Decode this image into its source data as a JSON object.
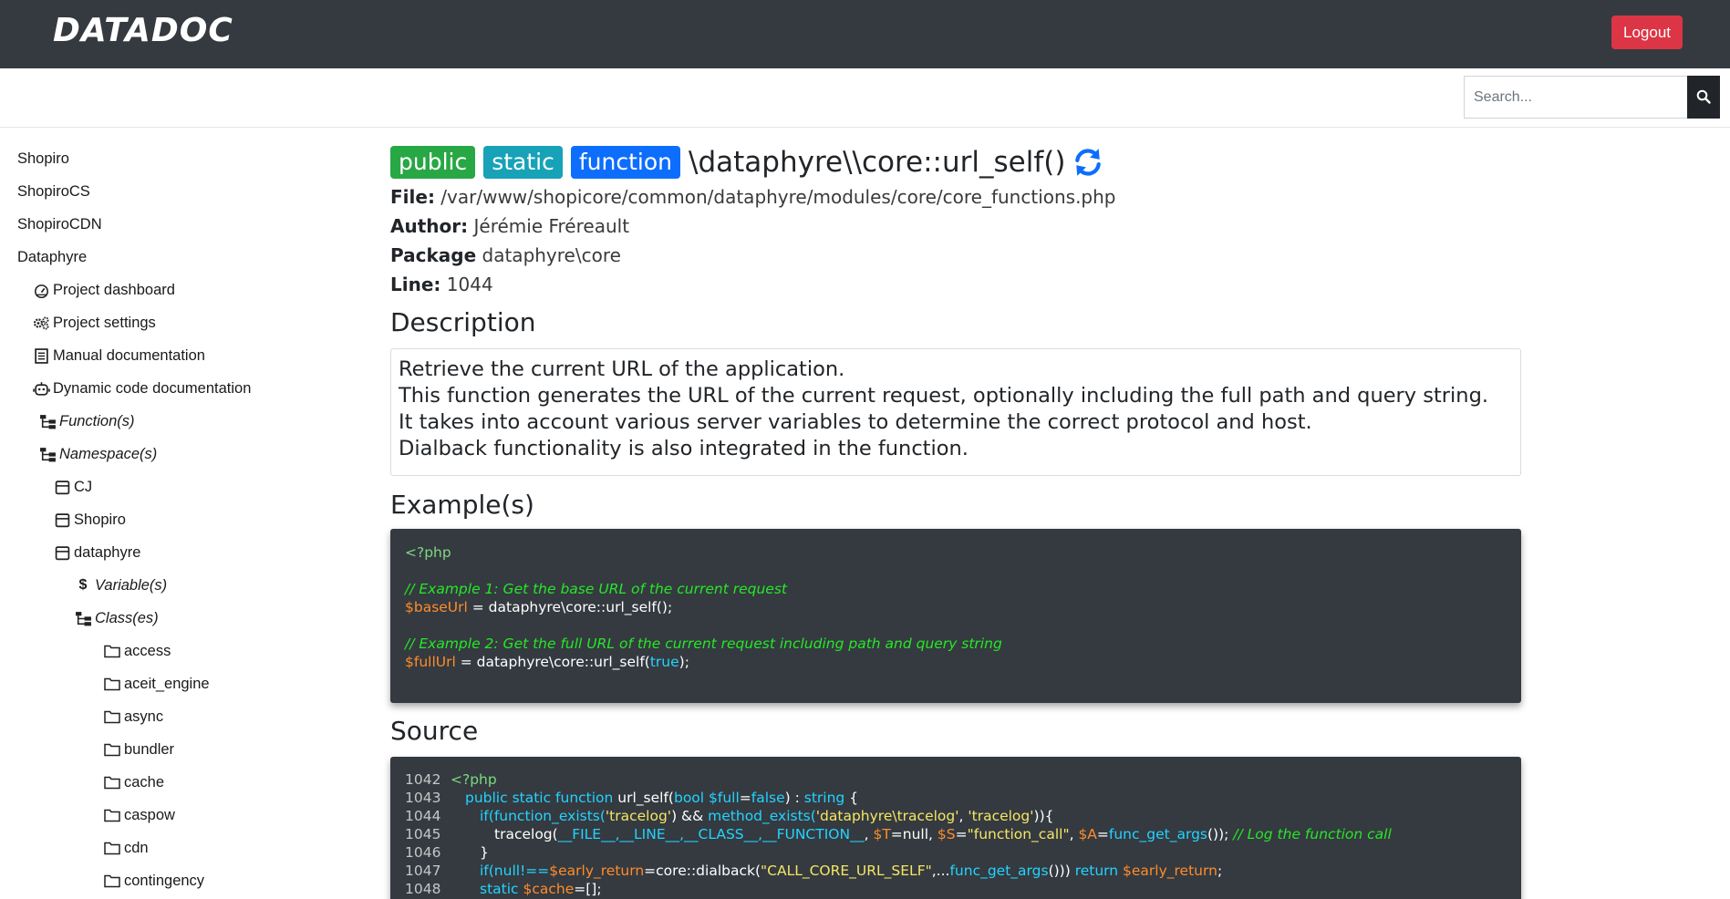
{
  "header": {
    "logo": "DATADOC",
    "logout_label": "Logout"
  },
  "search": {
    "placeholder": "Search...",
    "button_icon": "search-icon"
  },
  "sidebar": {
    "items": [
      {
        "label": "Shopiro",
        "icon": ""
      },
      {
        "label": "ShopiroCS",
        "icon": ""
      },
      {
        "label": "ShopiroCDN",
        "icon": ""
      },
      {
        "label": "Dataphyre",
        "icon": ""
      },
      {
        "label": "Project dashboard",
        "icon": "dashboard-icon"
      },
      {
        "label": "Project settings",
        "icon": "gears-icon"
      },
      {
        "label": "Manual documentation",
        "icon": "document-icon"
      },
      {
        "label": "Dynamic code documentation",
        "icon": "robot-icon"
      },
      {
        "label": "Function(s)",
        "icon": "tree-icon"
      },
      {
        "label": "Namespace(s)",
        "icon": "tree-icon"
      },
      {
        "label": "CJ",
        "icon": "box-icon"
      },
      {
        "label": "Shopiro",
        "icon": "box-icon"
      },
      {
        "label": "dataphyre",
        "icon": "box-icon"
      },
      {
        "label": "Variable(s)",
        "icon": "dollar-icon",
        "glyph": "$"
      },
      {
        "label": "Class(es)",
        "icon": "tree-icon"
      },
      {
        "label": "access",
        "icon": "folder-icon"
      },
      {
        "label": "aceit_engine",
        "icon": "folder-icon"
      },
      {
        "label": "async",
        "icon": "folder-icon"
      },
      {
        "label": "bundler",
        "icon": "folder-icon"
      },
      {
        "label": "cache",
        "icon": "folder-icon"
      },
      {
        "label": "caspow",
        "icon": "folder-icon"
      },
      {
        "label": "cdn",
        "icon": "folder-icon"
      },
      {
        "label": "contingency",
        "icon": "folder-icon"
      }
    ]
  },
  "main": {
    "badges": [
      "public",
      "static",
      "function"
    ],
    "function_name": "\\dataphyre\\\\core::url_self()",
    "refresh_icon": "refresh-icon",
    "meta": {
      "file_label": "File:",
      "file_value": "/var/www/shopicore/common/dataphyre/modules/core/core_functions.php",
      "author_label": "Author:",
      "author_value": "Jérémie Fréreault",
      "package_label": "Package",
      "package_value": "dataphyre\\core",
      "line_label": "Line:",
      "line_value": "1044"
    },
    "description_heading": "Description",
    "description_lines": [
      "Retrieve the current URL of the application.",
      "This function generates the URL of the current request, optionally including the full path and query string.",
      "It takes into account various server variables to determine the correct protocol and host.",
      "Dialback functionality is also integrated in the function."
    ],
    "examples_heading": "Example(s)",
    "example_code": {
      "php_open": "<?php",
      "comment1": "// Example 1: Get the base URL of the current request",
      "line1_var": "$baseUrl",
      "line1_rest": " = dataphyre\\core::url_self();",
      "comment2": "// Example 2: Get the full URL of the current request including path and query string",
      "line2_var": "$fullUrl",
      "line2_mid": " = dataphyre\\core::url_self(",
      "line2_arg": "true",
      "line2_end": ");"
    },
    "source_heading": "Source",
    "source_code": {
      "line_numbers": [
        "1042",
        "1043",
        "1044",
        "1045",
        "1046",
        "1047",
        "1048"
      ],
      "l1042": "<?php",
      "l1043_a": "public static function",
      "l1043_b": " url_self(",
      "l1043_c": "bool $full",
      "l1043_d": "=",
      "l1043_e": "false",
      "l1043_f": ") : ",
      "l1043_g": "string",
      "l1043_h": " {",
      "l1044_a": "if(",
      "l1044_b": "function_exists(",
      "l1044_c": "'tracelog'",
      "l1044_d": ") && ",
      "l1044_e": "method_exists(",
      "l1044_f": "'dataphyre\\tracelog'",
      "l1044_g": ", ",
      "l1044_h": "'tracelog'",
      "l1044_i": ")){",
      "l1045_a": "tracelog(",
      "l1045_b": "__FILE__,__LINE__,__CLASS__,__FUNCTION__",
      "l1045_c": ", ",
      "l1045_d": "$T",
      "l1045_e": "=null, ",
      "l1045_f": "$S",
      "l1045_g": "=",
      "l1045_h": "\"function_call\"",
      "l1045_i": ", ",
      "l1045_j": "$A",
      "l1045_k": "=",
      "l1045_l": "func_get_args",
      "l1045_m": "()); ",
      "l1045_n": "// Log the function call",
      "l1046": "}",
      "l1047_a": "if(null!==",
      "l1047_b": "$early_return",
      "l1047_c": "=core::dialback(",
      "l1047_d": "\"CALL_CORE_URL_SELF\"",
      "l1047_e": ",...",
      "l1047_f": "func_get_args",
      "l1047_g": "())) ",
      "l1047_h": "return",
      "l1047_i": " ",
      "l1047_j": "$early_return",
      "l1047_k": ";",
      "l1048_a": "static",
      "l1048_b": " ",
      "l1048_c": "$cache",
      "l1048_d": "=[];"
    }
  },
  "colors": {
    "header_bg": "#343a40",
    "logout": "#dc3545",
    "badge_public": "#28a745",
    "badge_static": "#17a2b8",
    "badge_function": "#0d6efd",
    "code_bg": "#343a40"
  }
}
